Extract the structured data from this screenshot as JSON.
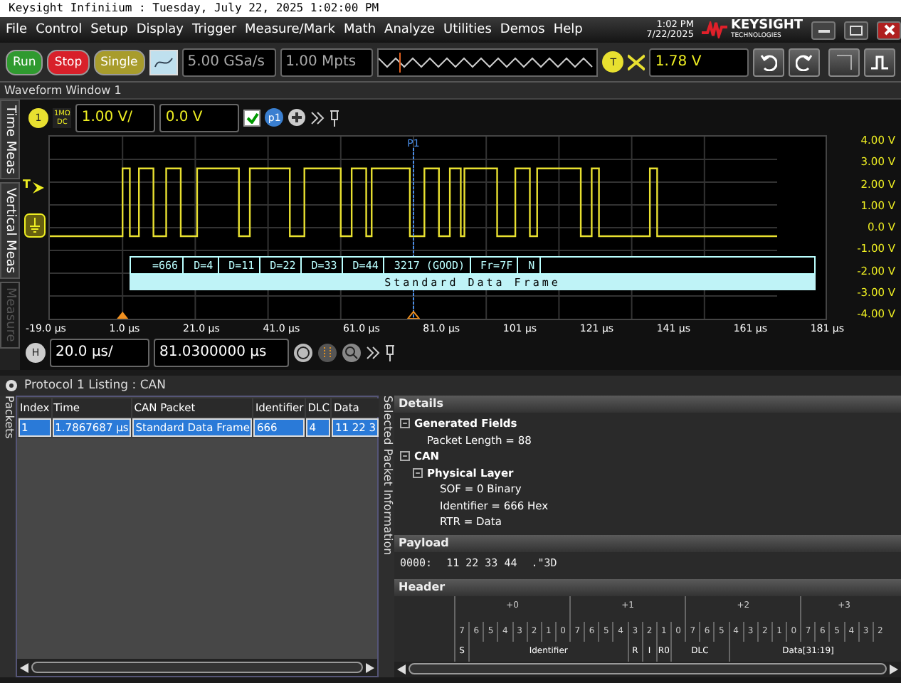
{
  "title_bar": {
    "text": "Keysight Infiniium : Tuesday, July 22, 2025 1:02:00 PM"
  },
  "menu": [
    "File",
    "Control",
    "Setup",
    "Display",
    "Trigger",
    "Measure/Mark",
    "Math",
    "Analyze",
    "Utilities",
    "Demos",
    "Help"
  ],
  "clock": {
    "time": "1:02 PM",
    "date": "7/22/2025"
  },
  "logo": {
    "name": "KEYSIGHT",
    "sub": "TECHNOLOGIES"
  },
  "toolbar": {
    "buttons": [
      {
        "label": "Run",
        "color": "#2f9a2f"
      },
      {
        "label": "Stop",
        "color": "#d8202a"
      },
      {
        "label": "Single",
        "color": "#a89c2c"
      }
    ],
    "sample_rate": "5.00 GSa/s",
    "memory": "1.00 Mpts",
    "trigger_badge": "T",
    "trigger_level": "1.78 V"
  },
  "waveform_window": {
    "title": "Waveform Window 1",
    "side_tabs": [
      {
        "label": "Time Meas",
        "disabled": false
      },
      {
        "label": "Vertical Meas",
        "disabled": false
      },
      {
        "label": "Measure",
        "disabled": true
      }
    ]
  },
  "channel": {
    "number": "1",
    "coupling_top": "1MΩ",
    "coupling_bottom": "DC",
    "scale": "1.00 V/",
    "offset": "0.0 V",
    "enabled": true,
    "probe_badge": "p1"
  },
  "plot": {
    "marker": "P1",
    "trigger_mark": "T",
    "y_labels": [
      "4.00 V",
      "3.00 V",
      "2.00 V",
      "1.00 V",
      "0.0 V",
      "-1.00 V",
      "-2.00 V",
      "-3.00 V",
      "-4.00 V"
    ],
    "x_labels": [
      "-19.0 µs",
      "1.0 µs",
      "21.0 µs",
      "41.0 µs",
      "61.0 µs",
      "81.0 µs",
      "101 µs",
      "121 µs",
      "141 µs",
      "161 µs",
      "181 µs"
    ],
    "decode": {
      "segments": [
        "=666",
        "D=4",
        "D=11",
        "D=22",
        "D=33",
        "D=44",
        "3217 (GOOD)",
        "Fr=7F",
        "N"
      ],
      "frame": "Standard Data Frame"
    }
  },
  "horizontal": {
    "badge": "H",
    "scale": "20.0 µs/",
    "position": "81.0300000 µs"
  },
  "listing": {
    "title": "Protocol 1 Listing : CAN",
    "side_tab": "Packets",
    "columns": [
      "Index",
      "Time",
      "CAN Packet",
      "Identifier",
      "DLC",
      "Data"
    ],
    "rows": [
      {
        "cells": [
          "1",
          "1.7867687 µs",
          "Standard Data Frame",
          "666",
          "4",
          "11 22 3"
        ],
        "selected": true
      }
    ]
  },
  "details": {
    "side_tab": "Selected Packet Information",
    "title": "Details",
    "tree": [
      {
        "label": "Generated Fields",
        "expanded": true,
        "children": [
          {
            "label": "Packet Length = 88"
          }
        ]
      },
      {
        "label": "CAN",
        "expanded": true,
        "children": [
          {
            "label": "Physical Layer",
            "expanded": true,
            "children": [
              {
                "label": "SOF = 0 Binary"
              },
              {
                "label": "Identifier = 666 Hex"
              },
              {
                "label": "RTR = Data"
              }
            ]
          }
        ]
      }
    ]
  },
  "payload": {
    "title": "Payload",
    "offset": "0000:",
    "bytes": "11 22 33 44",
    "ascii": ".\"3D"
  },
  "header": {
    "title": "Header",
    "byte_groups": [
      "+0",
      "+1",
      "+2",
      "+3"
    ],
    "bits": [
      "7",
      "6",
      "5",
      "4",
      "3",
      "2",
      "1",
      "0",
      "7",
      "6",
      "5",
      "4",
      "3",
      "2",
      "1",
      "0",
      "7",
      "6",
      "5",
      "4",
      "3",
      "2",
      "1",
      "0",
      "7",
      "6",
      "5",
      "4",
      "3",
      "2"
    ],
    "fields": [
      "S",
      "Identifier",
      "R",
      "I",
      "R0",
      "DLC",
      "Data[31:19]"
    ]
  }
}
